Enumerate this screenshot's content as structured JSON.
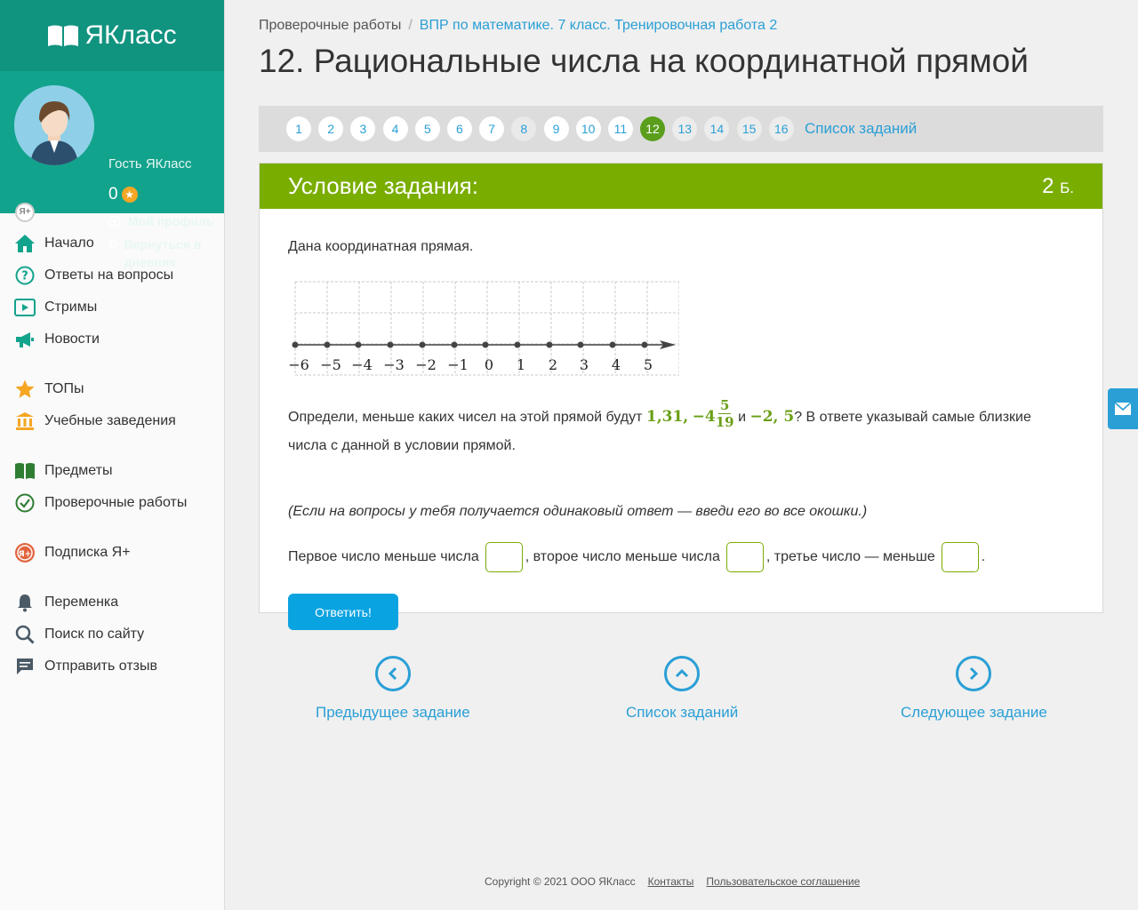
{
  "brand": {
    "name": "ЯКласс"
  },
  "user": {
    "name": "Гость ЯКласс",
    "score": "0",
    "badge": "Я+",
    "links": [
      "Мой профиль",
      "Вернуться в дневник"
    ]
  },
  "nav": {
    "groups": [
      [
        {
          "label": "Начало",
          "icon": "home-icon"
        },
        {
          "label": "Ответы на вопросы",
          "icon": "question-icon"
        },
        {
          "label": "Стримы",
          "icon": "play-icon"
        },
        {
          "label": "Новости",
          "icon": "megaphone-icon"
        }
      ],
      [
        {
          "label": "ТОПы",
          "icon": "star-icon"
        },
        {
          "label": "Учебные заведения",
          "icon": "building-icon"
        }
      ],
      [
        {
          "label": "Предметы",
          "icon": "book-icon"
        },
        {
          "label": "Проверочные работы",
          "icon": "check-circle-icon"
        }
      ],
      [
        {
          "label": "Подписка Я+",
          "icon": "yaplus-icon"
        }
      ],
      [
        {
          "label": "Переменка",
          "icon": "bell-icon"
        },
        {
          "label": "Поиск по сайту",
          "icon": "search-icon"
        },
        {
          "label": "Отправить отзыв",
          "icon": "comment-icon"
        }
      ]
    ]
  },
  "breadcrumb": {
    "first": "Проверочные работы",
    "second": "ВПР по математике. 7 класс. Тренировочная работа 2"
  },
  "page_title": "12. Рациональные числа на координатной прямой",
  "pager": {
    "pages": [
      "1",
      "2",
      "3",
      "4",
      "5",
      "6",
      "7",
      "8",
      "9",
      "10",
      "11",
      "12",
      "13",
      "14",
      "15",
      "16"
    ],
    "current": "12",
    "done": [
      "8"
    ],
    "list_label": "Список заданий"
  },
  "task": {
    "header": "Условие задания:",
    "points": "2",
    "points_unit": "Б.",
    "intro": "Дана координатная прямая.",
    "numberline_labels": [
      "−6",
      "−5",
      "−4",
      "−3",
      "−2",
      "−1",
      "0",
      "1",
      "2",
      "3",
      "4",
      "5"
    ],
    "question_prefix": "Определи, меньше каких чисел на этой прямой будут",
    "n1": "1,31,",
    "n2_whole": "−4",
    "n2_num": "5",
    "n2_den": "19",
    "and": "и",
    "n3": "−2, 5",
    "question_suffix": "? В ответе указывай самые близкие числа с данной в условии прямой.",
    "hint": "(Если на вопросы у тебя получается одинаковый ответ — введи его во все окошки.)",
    "answer_parts": [
      "Первое число меньше числа",
      ", второе число меньше числа",
      ", третье число — меньше",
      "."
    ],
    "submit": "Ответить!"
  },
  "bottom_nav": {
    "prev": "Предыдущее задание",
    "list": "Список заданий",
    "next": "Следующее задание"
  },
  "footer": {
    "copyright": "Copyright © 2021 ООО ЯКласс",
    "contacts": "Контакты",
    "agreement": "Пользовательское соглашение"
  },
  "colors": {
    "teal": "#12a38c",
    "green": "#79ad00",
    "blue": "#2a9fd6",
    "button": "#0aa3e1"
  }
}
